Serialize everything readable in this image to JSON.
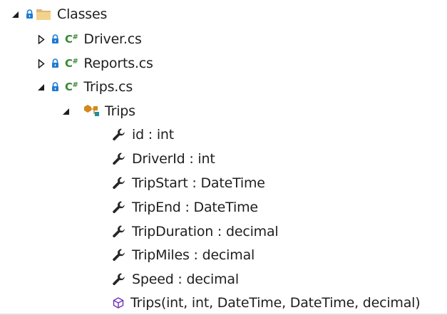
{
  "tree": {
    "root": {
      "label": "Classes",
      "icon": "folder-icon",
      "expanded": true
    },
    "files": [
      {
        "label": "Driver.cs",
        "icon": "csharp-file-icon",
        "expanded": false
      },
      {
        "label": "Reports.cs",
        "icon": "csharp-file-icon",
        "expanded": false
      },
      {
        "label": "Trips.cs",
        "icon": "csharp-file-icon",
        "expanded": true
      }
    ],
    "class_node": {
      "label": "Trips",
      "icon": "class-icon",
      "expanded": true
    },
    "properties": [
      {
        "label": "id : int",
        "icon": "wrench-icon"
      },
      {
        "label": "DriverId : int",
        "icon": "wrench-icon"
      },
      {
        "label": "TripStart : DateTime",
        "icon": "wrench-icon"
      },
      {
        "label": "TripEnd : DateTime",
        "icon": "wrench-icon"
      },
      {
        "label": "TripDuration : decimal",
        "icon": "wrench-icon"
      },
      {
        "label": "TripMiles : decimal",
        "icon": "wrench-icon"
      },
      {
        "label": "Speed : decimal",
        "icon": "wrench-icon"
      }
    ],
    "constructor": {
      "label": "Trips(int, int, DateTime, DateTime, decimal)",
      "icon": "method-cube-icon"
    }
  },
  "colors": {
    "folder": "#dcb67a",
    "csharp": "#388a34",
    "lock": "#1e7bd0",
    "class_orange": "#d4881e",
    "class_teal": "#1e8f9c",
    "wrench": "#262626",
    "method": "#6b2fba",
    "arrow": "#1e1e1e"
  },
  "csharp_text": "C",
  "csharp_sup": "#"
}
